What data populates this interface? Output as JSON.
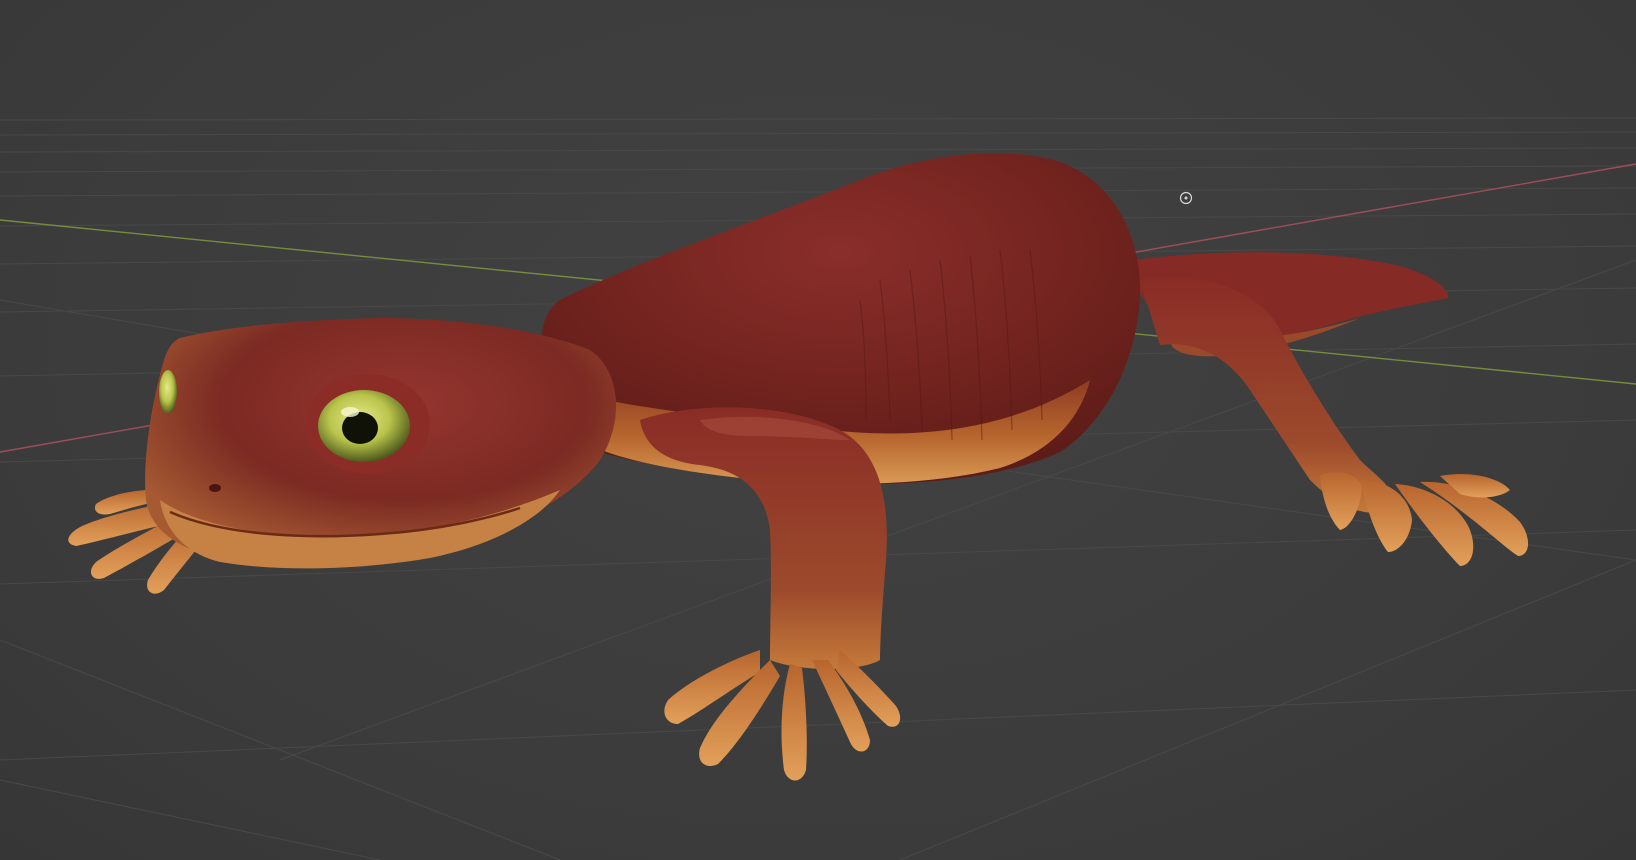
{
  "viewport": {
    "background": "#3d3d3d",
    "grid_color": "#4a4a4a",
    "x_axis_color": "#b0525b",
    "y_axis_color": "#7e9c3e"
  },
  "model": {
    "body_color": "#7a2424",
    "belly_color": "#c9833f",
    "eye_color": "#b9c44b"
  },
  "cursor": {
    "icon": "3d-cursor-icon"
  }
}
